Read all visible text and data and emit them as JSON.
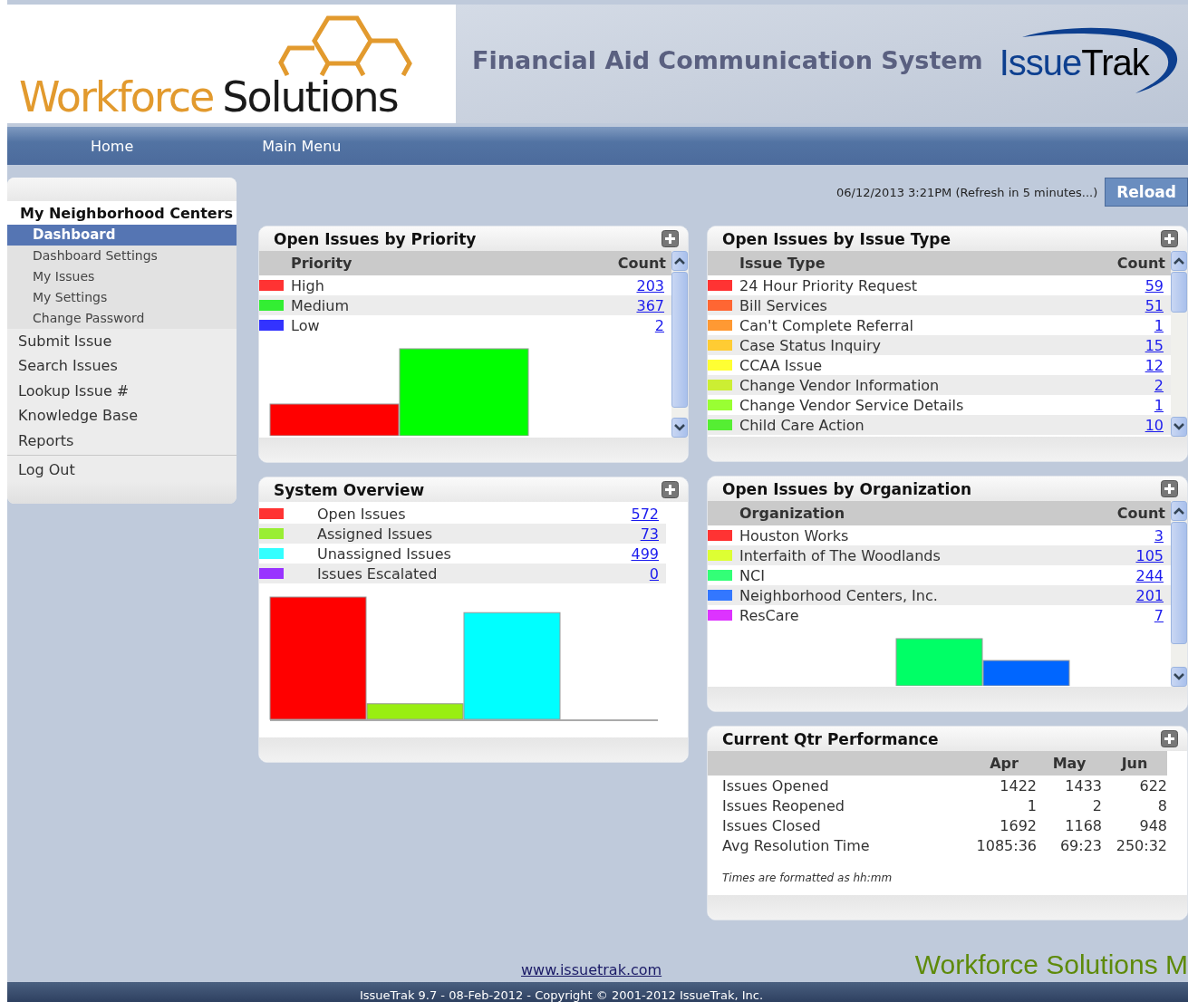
{
  "header": {
    "logo": {
      "first": "Workforce",
      "second": "Solutions"
    },
    "title": "Financial Aid Communication System",
    "product_logo": {
      "first": "Issue",
      "second": "Trak"
    }
  },
  "nav": [
    {
      "label": "Home"
    },
    {
      "label": "Main Menu"
    }
  ],
  "sidebar": {
    "heading": "My Neighborhood Centers",
    "subitems": [
      {
        "label": "Dashboard",
        "selected": true
      },
      {
        "label": "Dashboard Settings",
        "selected": false
      },
      {
        "label": "My Issues",
        "selected": false
      },
      {
        "label": "My Settings",
        "selected": false
      },
      {
        "label": "Change Password",
        "selected": false
      }
    ],
    "items": [
      "Submit Issue",
      "Search Issues",
      "Lookup Issue #",
      "Knowledge Base",
      "Reports"
    ],
    "bottom_items": [
      "Log Out"
    ]
  },
  "status": {
    "timestamp": "06/12/2013 3:21PM (Refresh in 5 minutes...)",
    "button": "Reload"
  },
  "left_column": [
    {
      "kind": "legend",
      "title": "Open Issues by Priority",
      "columns": [
        "Priority",
        "Count"
      ],
      "rows": [
        {
          "label": "High",
          "count": "203",
          "color": "#ff3333"
        },
        {
          "label": "Medium",
          "count": "367",
          "color": "#33ee33"
        },
        {
          "label": "Low",
          "count": "2",
          "color": "#3333ff"
        }
      ]
    },
    {
      "kind": "summary",
      "title": "System Overview",
      "rows": [
        {
          "label": "Open Issues",
          "count": "572",
          "color": "#ff3333"
        },
        {
          "label": "Assigned Issues",
          "count": "73",
          "color": "#99ee33"
        },
        {
          "label": "Unassigned Issues",
          "count": "499",
          "color": "#33ffff"
        },
        {
          "label": "Issues Escalated",
          "count": "0",
          "color": "#9933ff"
        }
      ]
    }
  ],
  "right_column": [
    {
      "kind": "legend",
      "title": "Open Issues by Issue Type",
      "columns": [
        "Issue Type",
        "Count"
      ],
      "rows": [
        {
          "label": "24 Hour Priority Request",
          "count": "59",
          "color": "#ff3333"
        },
        {
          "label": "Bill Services",
          "count": "51",
          "color": "#ff6633"
        },
        {
          "label": "Can't Complete Referral",
          "count": "1",
          "color": "#ff9933"
        },
        {
          "label": "Case Status Inquiry",
          "count": "15",
          "color": "#ffcc33"
        },
        {
          "label": "CCAA Issue",
          "count": "12",
          "color": "#ffff33"
        },
        {
          "label": "Change Vendor Information",
          "count": "2",
          "color": "#ccee33"
        },
        {
          "label": "Change Vendor Service Details",
          "count": "1",
          "color": "#99ff33"
        },
        {
          "label": "Child Care Action",
          "count": "10",
          "color": "#55ee33"
        }
      ]
    },
    {
      "kind": "legend",
      "title": "Open Issues by Organization",
      "columns": [
        "Organization",
        "Count"
      ],
      "rows": [
        {
          "label": "Houston Works",
          "count": "3",
          "color": "#ff3333"
        },
        {
          "label": "Interfaith of The Woodlands",
          "count": "105",
          "color": "#ddff33"
        },
        {
          "label": "NCI",
          "count": "244",
          "color": "#33ff77"
        },
        {
          "label": "Neighborhood Centers, Inc.",
          "count": "201",
          "color": "#3377ff"
        },
        {
          "label": "ResCare",
          "count": "7",
          "color": "#dd33ff"
        }
      ]
    },
    {
      "kind": "table",
      "title": "Current Qtr Performance",
      "columns": [
        "Apr",
        "May",
        "Jun"
      ],
      "rows": [
        {
          "label": "Issues Opened",
          "values": [
            "1422",
            "1433",
            "622"
          ]
        },
        {
          "label": "Issues Reopened",
          "values": [
            "1",
            "2",
            "8"
          ]
        },
        {
          "label": "Issues Closed",
          "values": [
            "1692",
            "1168",
            "948"
          ]
        },
        {
          "label": "Avg Resolution Time",
          "values": [
            "1085:36",
            "69:23",
            "250:32"
          ]
        }
      ],
      "note": "Times are formatted as hh:mm"
    }
  ],
  "footer": {
    "link": "www.issuetrak.com",
    "brand": "Workforce Solutions M",
    "copyright": "IssueTrak 9.7 - 08-Feb-2012 - Copyright © 2001-2012 IssueTrak, Inc."
  }
}
